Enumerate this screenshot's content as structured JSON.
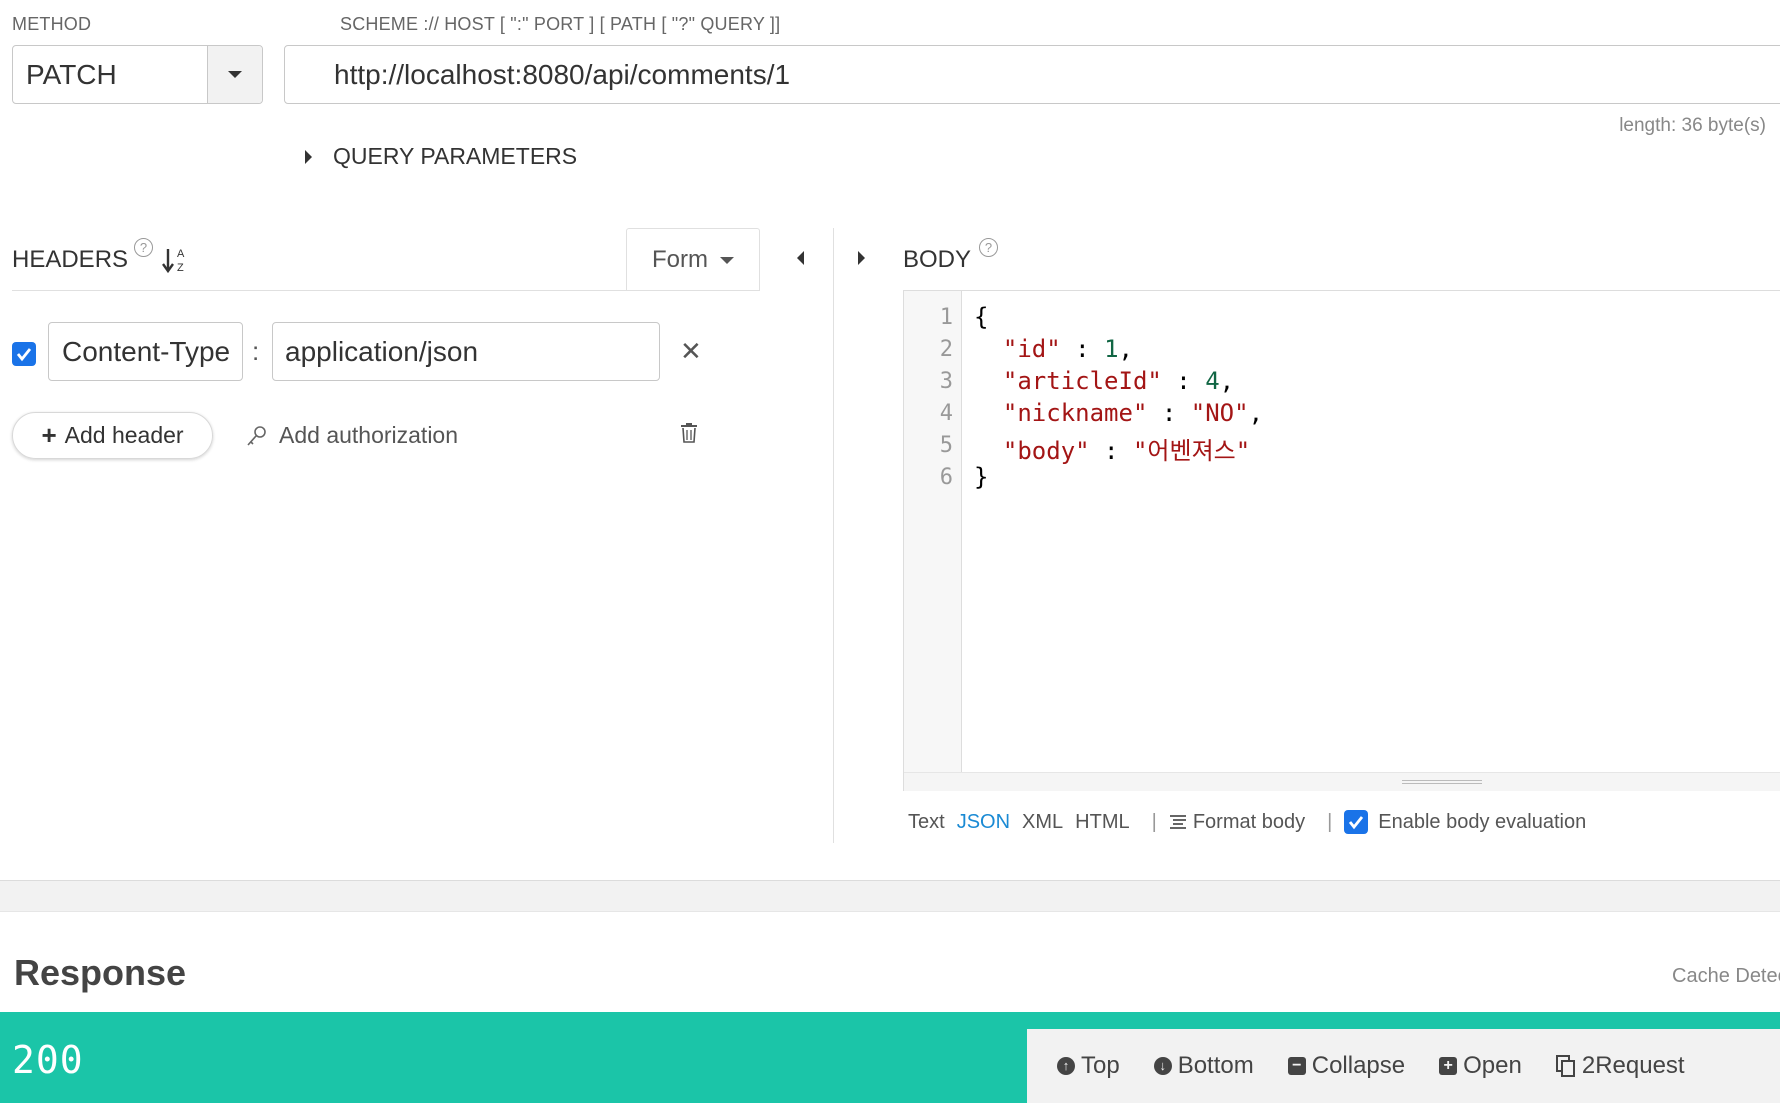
{
  "request": {
    "method_label": "METHOD",
    "method_value": "PATCH",
    "url_label": "SCHEME :// HOST [ \":\" PORT ] [ PATH [ \"?\" QUERY ]]",
    "url_value": "http://localhost:8080/api/comments/1",
    "length_info": "length: 36 byte(s)",
    "query_params_label": "QUERY PARAMETERS"
  },
  "headers": {
    "title": "HEADERS",
    "form_label": "Form",
    "rows": [
      {
        "enabled": true,
        "name": "Content-Type",
        "value": "application/json"
      }
    ],
    "add_header_label": "Add header",
    "add_auth_label": "Add authorization"
  },
  "body": {
    "title": "BODY",
    "line_numbers": [
      "1",
      "2",
      "3",
      "4",
      "5",
      "6"
    ],
    "lines": [
      {
        "k": "",
        "v": "{"
      },
      {
        "k": "\"id\"",
        "v": "1"
      },
      {
        "k": "\"articleId\"",
        "v": "4"
      },
      {
        "k": "\"nickname\"",
        "v": "\"NO\""
      },
      {
        "k": "\"body\"",
        "v": "\"어벤져스\""
      },
      {
        "k": "",
        "v": "}"
      }
    ],
    "formats": [
      "Text",
      "JSON",
      "XML",
      "HTML"
    ],
    "active_format": "JSON",
    "format_body_label": "Format body",
    "enable_eval_label": "Enable body evaluation"
  },
  "response": {
    "title": "Response",
    "cache_label": "Cache Detec",
    "status_code": "200",
    "toolbar": {
      "top": "Top",
      "bottom": "Bottom",
      "collapse": "Collapse",
      "open": "Open",
      "to_request": "2Request"
    }
  },
  "colors": {
    "status_bg": "#1bc5a8",
    "accent": "#1a73e8",
    "json_key": "#a31515",
    "json_number": "#116644"
  }
}
